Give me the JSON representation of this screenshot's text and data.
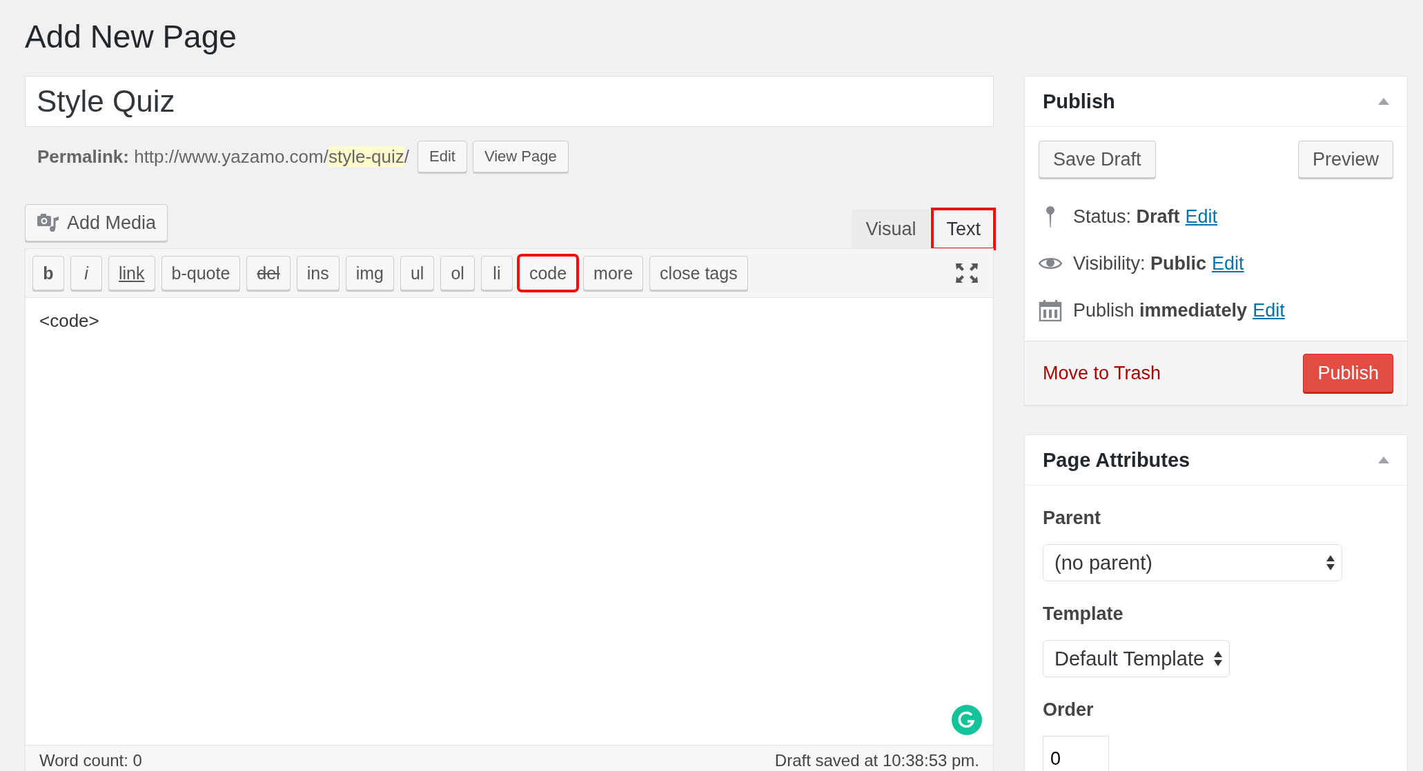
{
  "heading": "Add New Page",
  "title_field": {
    "value": "Style Quiz"
  },
  "permalink": {
    "label": "Permalink:",
    "base": "http://www.yazamo.com/",
    "slug": "style-quiz",
    "trail": "/",
    "buttons": [
      "Edit",
      "View Page"
    ]
  },
  "add_media": "Add Media",
  "editor_tabs": [
    {
      "label": "Visual",
      "selected": false,
      "highlighted": false
    },
    {
      "label": "Text",
      "selected": true,
      "highlighted": true
    }
  ],
  "toolbar": [
    {
      "label": "b",
      "kind": "bold",
      "highlighted": false
    },
    {
      "label": "i",
      "kind": "italic",
      "highlighted": false
    },
    {
      "label": "link",
      "kind": "underline",
      "highlighted": false
    },
    {
      "label": "b-quote",
      "kind": "plain",
      "highlighted": false
    },
    {
      "label": "del",
      "kind": "strike",
      "highlighted": false
    },
    {
      "label": "ins",
      "kind": "plain",
      "highlighted": false
    },
    {
      "label": "img",
      "kind": "plain",
      "highlighted": false
    },
    {
      "label": "ul",
      "kind": "plain",
      "highlighted": false
    },
    {
      "label": "ol",
      "kind": "plain",
      "highlighted": false
    },
    {
      "label": "li",
      "kind": "plain",
      "highlighted": false
    },
    {
      "label": "code",
      "kind": "plain",
      "highlighted": true
    },
    {
      "label": "more",
      "kind": "plain",
      "highlighted": false
    },
    {
      "label": "close tags",
      "kind": "plain",
      "highlighted": false
    }
  ],
  "editor_content": "<code>",
  "status_bar": {
    "word_count": "Word count: 0",
    "saved": "Draft saved at 10:38:53 pm."
  },
  "publish_box": {
    "title": "Publish",
    "save_draft": "Save Draft",
    "preview": "Preview",
    "rows": [
      {
        "kind": "pin",
        "text": "Status: **Draft**",
        "link": "Edit"
      },
      {
        "kind": "eye",
        "text": "Visibility: **Public**",
        "link": "Edit"
      },
      {
        "kind": "calendar",
        "text": "Publish **immediately**",
        "link": "Edit"
      }
    ],
    "trash": "Move to Trash",
    "publish": "Publish"
  },
  "attributes_box": {
    "title": "Page Attributes",
    "parent_label": "Parent",
    "parent_value": "(no parent)",
    "template_label": "Template",
    "template_value": "Default Template",
    "order_label": "Order",
    "order_value": "0"
  }
}
